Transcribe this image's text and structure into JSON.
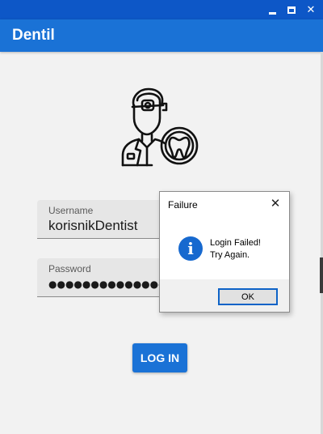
{
  "window": {
    "controls": {
      "minimize_icon": "minimize-icon",
      "maximize_icon": "maximize-icon",
      "close_icon": "close-icon"
    },
    "titlebar_color": "#0d57c7"
  },
  "app": {
    "title": "Dentil",
    "accent": "#1a72d6"
  },
  "logo": {
    "icon": "dentist-with-tooth-icon"
  },
  "form": {
    "username": {
      "label": "Username",
      "value": "korisnikDentist"
    },
    "password": {
      "label": "Password",
      "value": "●●●●●●●●●●●●●●"
    },
    "login_label": "LOG IN"
  },
  "dialog": {
    "title": "Failure",
    "close_glyph": "✕",
    "icon": "info-icon",
    "icon_glyph": "i",
    "message_line1": "Login Failed!",
    "message_line2": "Try Again.",
    "ok_label": "OK"
  }
}
